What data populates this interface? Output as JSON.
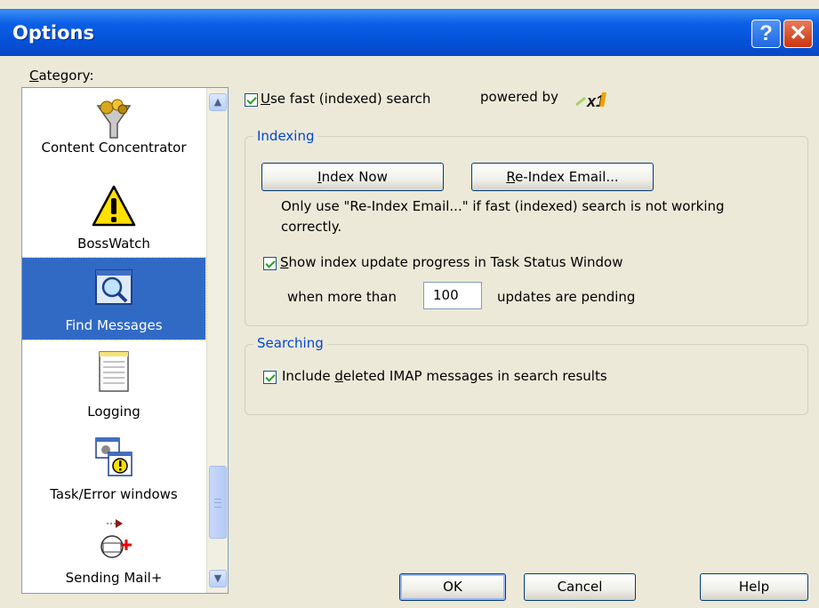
{
  "window": {
    "title": "Options"
  },
  "category": {
    "label": "Category:",
    "items": [
      {
        "label": "Content Concentrator",
        "icon": "funnel-icon"
      },
      {
        "label": "BossWatch",
        "icon": "warning-icon"
      },
      {
        "label": "Find Messages",
        "icon": "magnifier-icon",
        "selected": true
      },
      {
        "label": "Logging",
        "icon": "notepad-icon"
      },
      {
        "label": "Task/Error windows",
        "icon": "task-windows-icon"
      },
      {
        "label": "Sending Mail+",
        "icon": "sending-mail-icon"
      }
    ]
  },
  "search": {
    "fast_label": "Use fast (indexed) search",
    "fast_checked": true,
    "powered_by": "powered by",
    "brand": "x1"
  },
  "indexing": {
    "group_label": "Indexing",
    "index_now": "Index Now",
    "reindex": "Re-Index Email...",
    "note_line1": "Only use \"Re-Index Email...\" if fast (indexed) search is not working",
    "note_line2": "correctly.",
    "show_progress_label": "Show index update progress in Task Status Window",
    "show_progress_checked": true,
    "when_more_than": "when more than",
    "pending_value": "100",
    "pending_suffix": "updates are pending"
  },
  "searching": {
    "group_label": "Searching",
    "include_deleted_label": "Include deleted IMAP messages in search results",
    "include_deleted_checked": true
  },
  "footer": {
    "ok": "OK",
    "cancel": "Cancel",
    "help": "Help"
  },
  "colors": {
    "title_bar": "#0451d8",
    "selection": "#316ac5",
    "group_label": "#0046d5",
    "dialog_bg": "#ece9d8"
  }
}
